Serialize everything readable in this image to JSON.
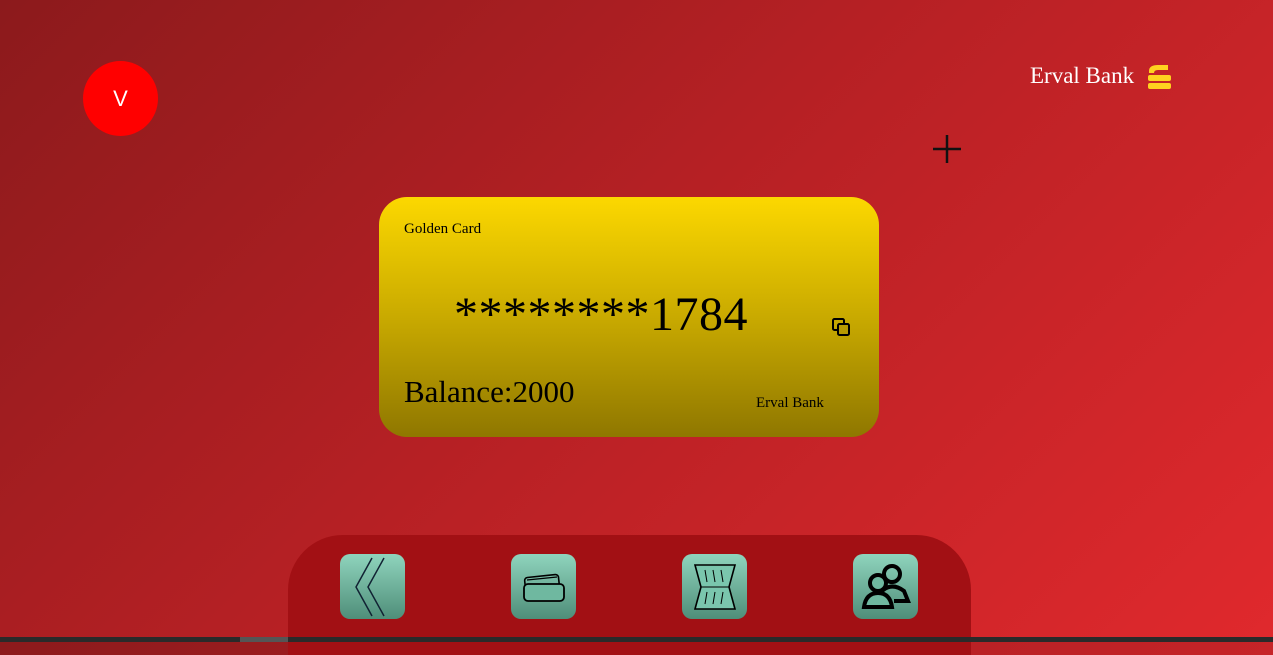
{
  "header": {
    "avatar_initial": "V",
    "brand_name": "Erval Bank",
    "brand_logo_icon": "stacked-coins-icon",
    "add_icon": "plus-icon"
  },
  "card": {
    "type_label": "Golden Card",
    "masked_number": "********1784",
    "copy_icon": "copy-icon",
    "balance_label": "Balance:2000",
    "bank_name": "Erval Bank",
    "gradient_colors": [
      "#fcd800",
      "#c9aa00",
      "#8f7700"
    ]
  },
  "nav": {
    "items": [
      {
        "icon": "back-chevron-icon"
      },
      {
        "icon": "credit-cards-icon"
      },
      {
        "icon": "transfer-icon"
      },
      {
        "icon": "users-icon"
      }
    ]
  },
  "colors": {
    "background": "#b52024",
    "avatar": "#ff0000",
    "navbar": "#a21014",
    "nav_button": "#6fb8a0",
    "brand_logo": "#ffd21f"
  }
}
